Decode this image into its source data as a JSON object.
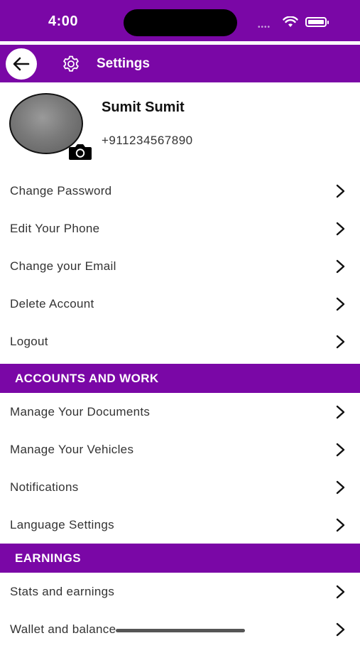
{
  "status_bar": {
    "time": "4:00"
  },
  "header": {
    "title": "Settings"
  },
  "profile": {
    "name": "Sumit Sumit",
    "phone": "+911234567890"
  },
  "account_items": [
    {
      "label": "Change Password"
    },
    {
      "label": "Edit Your Phone"
    },
    {
      "label": "Change your Email"
    },
    {
      "label": "Delete Account"
    },
    {
      "label": "Logout"
    }
  ],
  "sections": [
    {
      "title": "ACCOUNTS AND WORK",
      "items": [
        {
          "label": "Manage Your Documents"
        },
        {
          "label": "Manage Your Vehicles"
        },
        {
          "label": "Notifications"
        },
        {
          "label": "Language Settings"
        }
      ]
    },
    {
      "title": "EARNINGS",
      "items": [
        {
          "label": "Stats and earnings"
        },
        {
          "label": "Wallet and balance"
        }
      ]
    }
  ],
  "icons": {
    "back": "back-arrow-icon",
    "settings": "gear-icon",
    "camera": "camera-icon",
    "chevron": "chevron-right-icon"
  },
  "colors": {
    "accent": "#7a07a6",
    "background": "#ffffff",
    "text": "#333333"
  }
}
